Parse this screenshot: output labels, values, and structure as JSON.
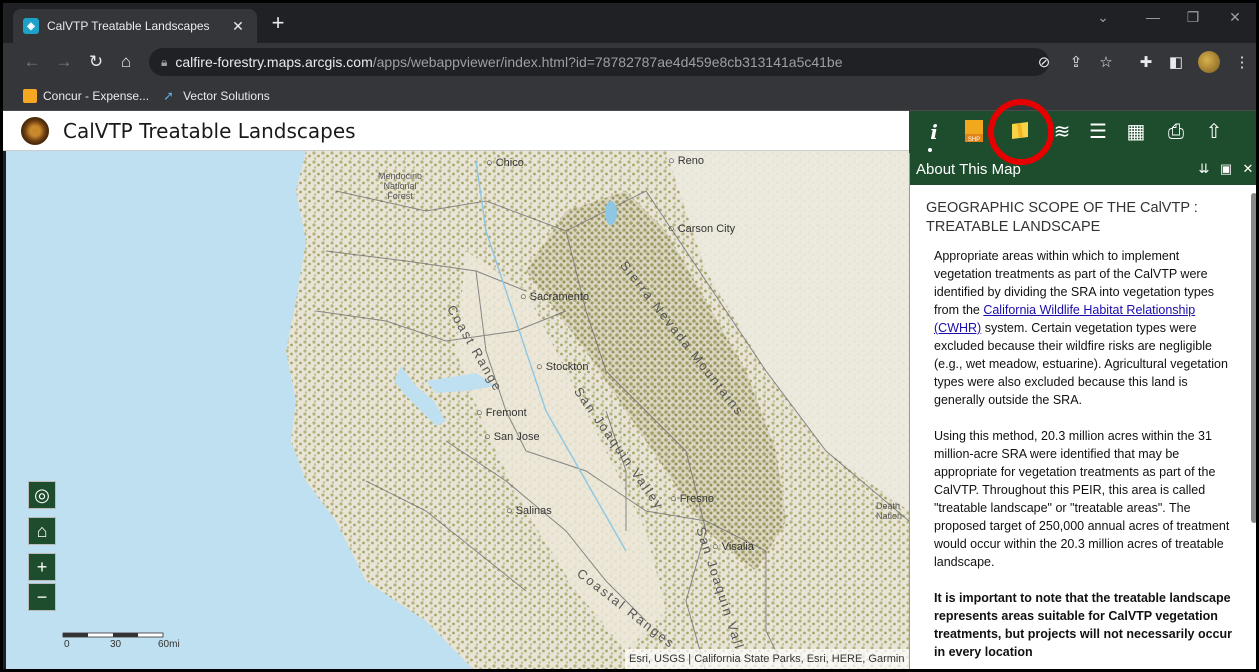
{
  "browser": {
    "tab_title": "CalVTP Treatable Landscapes",
    "tab_favicon": "arcgis-favicon",
    "url_host": "calfire-forestry.maps.arcgis.com",
    "url_path": "/apps/webappviewer/index.html?id=78782787ae4d459e8cb313141a5c41be",
    "bookmarks": [
      {
        "label": "Concur - Expense...",
        "icon": "concur-icon",
        "color": "#f5a623"
      },
      {
        "label": "Vector Solutions",
        "icon": "vector-solutions-icon",
        "color": "#5aa6e0"
      }
    ]
  },
  "app": {
    "title": "CalVTP Treatable Landscapes",
    "widgets": [
      {
        "name": "about-widget-icon",
        "glyph": "ℹ"
      },
      {
        "name": "shapefile-widget-icon",
        "glyph": "SHP"
      },
      {
        "name": "add-data-widget-icon",
        "glyph": "▰"
      },
      {
        "name": "layers-widget-icon",
        "glyph": "≋"
      },
      {
        "name": "legend-widget-icon",
        "glyph": "☰"
      },
      {
        "name": "basemap-gallery-widget-icon",
        "glyph": "▦"
      },
      {
        "name": "print-widget-icon",
        "glyph": "⎙"
      },
      {
        "name": "share-widget-icon",
        "glyph": "⇪"
      }
    ],
    "accent_color": "#1e4d2e",
    "highlight_color": "#e60000"
  },
  "map": {
    "labels": {
      "chico": "Chico",
      "reno": "Reno",
      "carson_city": "Carson City",
      "mendocino_nf": "Mendocino National Forest",
      "sacramento": "Sacramento",
      "stockton": "Stockton",
      "fremont": "Fremont",
      "san_jose": "San Jose",
      "salinas": "Salinas",
      "fresno": "Fresno",
      "visalia": "Visalia",
      "death_valley": "Death Nation",
      "coast_range": "Coast Range",
      "sierra_nevada": "Sierra Nevada Mountains",
      "san_joaquin_valley": "San Joaquin Valley",
      "coastal_ranges": "Coastal Ranges",
      "san_joaquin_valley_2": "San Joaquin Vall"
    },
    "scale": {
      "zero": "0",
      "mid": "30",
      "end": "60mi"
    },
    "attribution": "Esri, USGS | California State Parks, Esri, HERE, Garmin"
  },
  "panel": {
    "title": "About This Map",
    "heading": "GEOGRAPHIC SCOPE OF THE CalVTP : TREATABLE LANDSCAPE",
    "p1_before": "Appropriate areas within which to implement vegetation treatments as part of the CalVTP were identified by dividing the SRA into vegetation types from the ",
    "p1_link": "California Wildlife Habitat Relationship (CWHR)",
    "p1_after": " system. Certain vegetation types were excluded because their wildfire risks are negligible (e.g., wet meadow, estuarine). Agricultural vegetation types were also excluded because this land is generally outside the SRA.",
    "p2": "Using this method, 20.3 million acres within the 31 million-acre SRA were identified that may be appropriate for vegetation treatments as part of the CalVTP. Throughout this PEIR, this area is called \"treatable landscape\" or \"treatable areas\". The proposed target of 250,000 annual acres of treatment would occur within the 20.3 million acres of treatable landscape.",
    "p3": "It is important to note that the treatable landscape represents areas suitable for CalVTP vegetation treatments, but projects will not necessarily occur in every location"
  }
}
